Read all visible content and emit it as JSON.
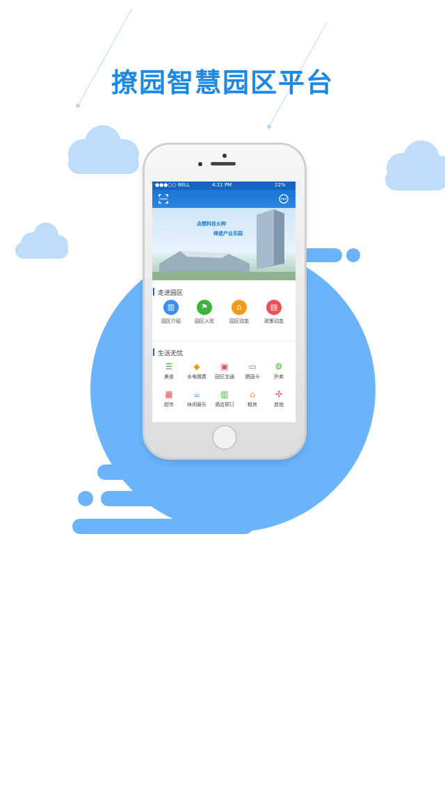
{
  "page": {
    "title": "撩园智慧园区平台"
  },
  "colors": {
    "accent": "#1e88e5",
    "blob": "#6bb4fb",
    "cloud": "#bfdcfb"
  },
  "status_bar": {
    "carrier": "●●●○○ BELL",
    "time": "4:21 PM",
    "battery": "22%"
  },
  "nav": {
    "left_icon": "scan-icon",
    "right_icon": "message-icon"
  },
  "banner": {
    "line1": "点燃科技火种",
    "line2": "缔造产业乐园"
  },
  "section1": {
    "title": "走进园区",
    "items": [
      {
        "label": "园区介绍",
        "icon": "building-icon",
        "color": "#3d8ef0"
      },
      {
        "label": "园区入驻",
        "icon": "flag-icon",
        "color": "#3cb43c"
      },
      {
        "label": "园区动态",
        "icon": "home-icon",
        "color": "#f39a1e"
      },
      {
        "label": "政策动态",
        "icon": "document-icon",
        "color": "#ef4f57"
      }
    ]
  },
  "section2": {
    "title": "生活无忧",
    "items": [
      {
        "label": "美食",
        "icon": "burger-icon",
        "color": "#3cb43c"
      },
      {
        "label": "水电缴费",
        "icon": "droplet-icon",
        "color": "#f39a1e"
      },
      {
        "label": "园区交通",
        "icon": "bus-icon",
        "color": "#ef4f57"
      },
      {
        "label": "撩园卡",
        "icon": "card-icon",
        "color": "#3d8ef0"
      },
      {
        "label": "外卖",
        "icon": "scooter-icon",
        "color": "#3cb43c"
      },
      {
        "label": "超市",
        "icon": "store-icon",
        "color": "#ef4f57"
      },
      {
        "label": "休闲娱乐",
        "icon": "coffee-icon",
        "color": "#3d8ef0"
      },
      {
        "label": "酒店预订",
        "icon": "hotel-icon",
        "color": "#3cb43c"
      },
      {
        "label": "租房",
        "icon": "house-icon",
        "color": "#f39a1e"
      },
      {
        "label": "其他",
        "icon": "grid-icon",
        "color": "#ef4f57"
      }
    ]
  }
}
